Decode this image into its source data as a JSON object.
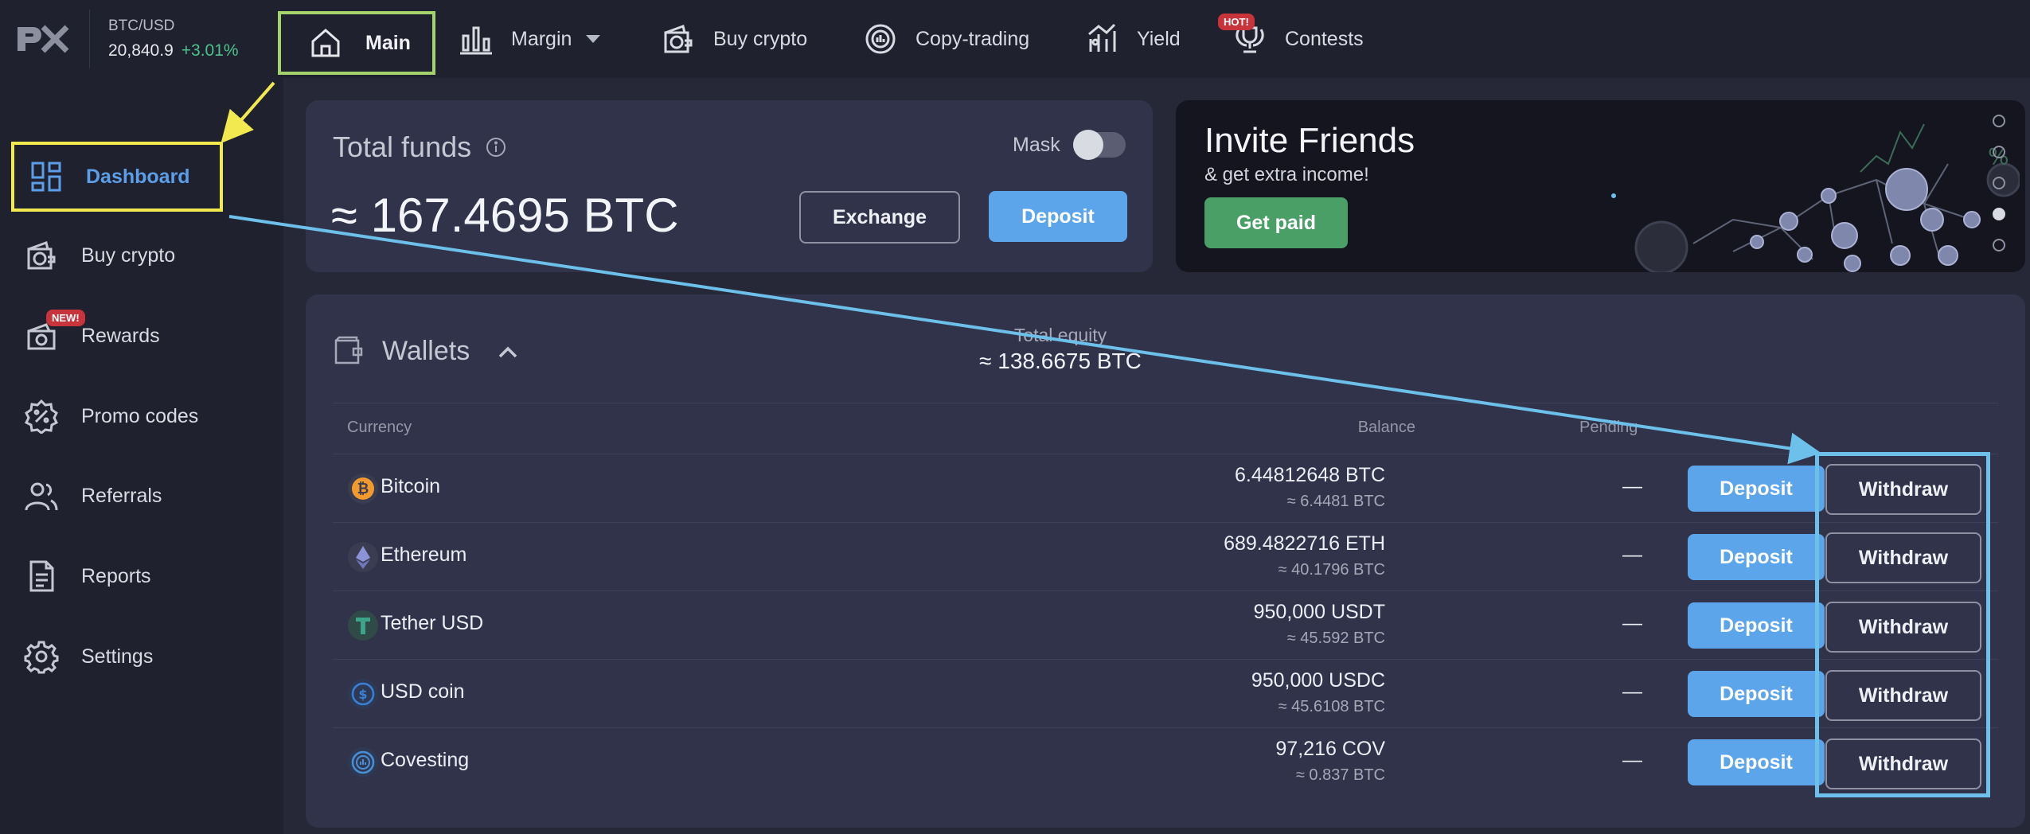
{
  "topbar": {
    "logo_icon": "px-logo",
    "ticker": {
      "pair": "BTC/USD",
      "price": "20,840.9",
      "change": "+3.01%"
    },
    "nav": [
      {
        "label": "Main",
        "icon": "home-icon"
      },
      {
        "label": "Margin",
        "icon": "bar-chart-icon"
      },
      {
        "label": "Buy crypto",
        "icon": "wallet-bitcoin-icon"
      },
      {
        "label": "Copy-trading",
        "icon": "copy-trading-icon"
      },
      {
        "label": "Yield",
        "icon": "yield-icon"
      },
      {
        "label": "Contests",
        "icon": "trophy-icon",
        "badge": "HOT!"
      }
    ]
  },
  "sidebar": {
    "items": [
      {
        "label": "Dashboard",
        "icon": "dashboard-icon"
      },
      {
        "label": "Buy crypto",
        "icon": "wallet-bitcoin-icon"
      },
      {
        "label": "Rewards",
        "icon": "rewards-icon",
        "badge": "NEW!"
      },
      {
        "label": "Promo codes",
        "icon": "promo-icon"
      },
      {
        "label": "Referrals",
        "icon": "users-icon"
      },
      {
        "label": "Reports",
        "icon": "document-icon"
      },
      {
        "label": "Settings",
        "icon": "gear-icon"
      }
    ]
  },
  "funds": {
    "title": "Total funds",
    "amount": "≈ 167.4695 BTC",
    "mask_label": "Mask",
    "exchange_label": "Exchange",
    "deposit_label": "Deposit"
  },
  "invite": {
    "title": "Invite Friends",
    "subtitle": "& get extra income!",
    "button_label": "Get paid"
  },
  "wallets": {
    "title": "Wallets",
    "equity_label": "Total equity",
    "equity_value": "≈ 138.6675 BTC",
    "columns": {
      "currency": "Currency",
      "balance": "Balance",
      "pending": "Pending"
    },
    "rows": [
      {
        "name": "Bitcoin",
        "balance": "6.44812648 BTC",
        "balance_btc": "≈ 6.4481 BTC",
        "pending": "—",
        "deposit": "Deposit",
        "withdraw": "Withdraw",
        "icon": "bitcoin-icon",
        "color": "#f39a2d"
      },
      {
        "name": "Ethereum",
        "balance": "689.4822716 ETH",
        "balance_btc": "≈ 40.1796 BTC",
        "pending": "—",
        "deposit": "Deposit",
        "withdraw": "Withdraw",
        "icon": "ethereum-icon",
        "color": "#8b93d6"
      },
      {
        "name": "Tether USD",
        "balance": "950,000 USDT",
        "balance_btc": "≈ 45.592 BTC",
        "pending": "—",
        "deposit": "Deposit",
        "withdraw": "Withdraw",
        "icon": "tether-icon",
        "color": "#3aa58a"
      },
      {
        "name": "USD coin",
        "balance": "950,000 USDC",
        "balance_btc": "≈ 45.6108 BTC",
        "pending": "—",
        "deposit": "Deposit",
        "withdraw": "Withdraw",
        "icon": "usdc-icon",
        "color": "#3a80d6"
      },
      {
        "name": "Covesting",
        "balance": "97,216 COV",
        "balance_btc": "≈ 0.837 BTC",
        "pending": "—",
        "deposit": "Deposit",
        "withdraw": "Withdraw",
        "icon": "covesting-icon",
        "color": "#4a8fd6"
      }
    ]
  },
  "colors": {
    "accent_blue": "#5ca5ea",
    "green": "#4cc38a",
    "annotation_green": "#a5d36b",
    "annotation_yellow": "#f1e94f",
    "annotation_blue": "#6cc0ea"
  }
}
